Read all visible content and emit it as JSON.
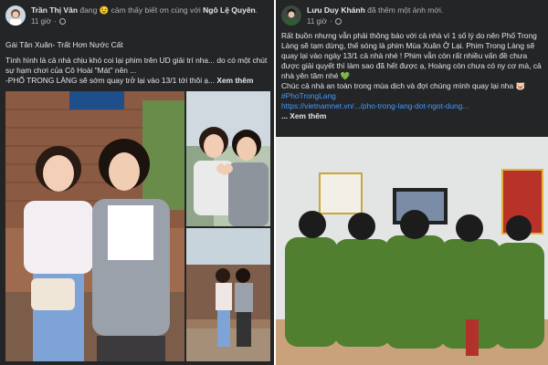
{
  "left_post": {
    "author": "Trần Thị Vân",
    "verb": "đang",
    "feeling_emoji": "😉",
    "feeling": "cảm thấy biết ơn cùng với",
    "tagged": "Ngô Lệ Quyên",
    "tagged_suffix": ".",
    "time": "11 giờ",
    "title": "Gái Tân Xuân- Trất Hơn Nước Cất",
    "paragraph": "Tình hình là cả nhà chịu khó coi lại phim trên UD giải trí nha... do có một chút sự hạm chơi của Cô Hoài \"Mát\" nên ...",
    "footer_line": " -PHỐ TRONG LÀNG sẽ sớm quay trở lại vào 13/1 tới thôi ạ...",
    "see_more": "Xem thêm"
  },
  "right_post": {
    "author": "Lưu Duy Khánh",
    "verb": "đã thêm một ảnh mới.",
    "time": "11 giờ",
    "paragraph": "Rất buồn nhưng vẫn phải thông báo với cả nhà vì 1 số lý do nên Phố Trong Làng sẽ tạm dừng, thế sóng là phim Mùa Xuân Ở Lại. Phim Trong Làng sẽ quay lại vào ngày 13/1 cả nhà nhé ! Phim vẫn còn rất nhiều vấn đề chưa được giải quyết thì làm sao đã hết được ạ, Hoàng còn chưa có ny cơ mà, cả nhà yên tâm nhé",
    "heart_emoji": "💚",
    "wish": "Chúc cả nhà an toàn trong mùa dịch và đợi chúng mình quay lại nha",
    "wish_emoji": "🐷",
    "hashtag": "#PhoTrongLang",
    "link": "https://vietnamnet.vn/.../pho-trong-lang-dot-ngot-dung...",
    "see_more": "... Xem thêm"
  },
  "colors": {
    "post_bg": "#242526",
    "text": "#e4e6eb",
    "muted": "#b0b3b8",
    "link": "#4599ff"
  }
}
